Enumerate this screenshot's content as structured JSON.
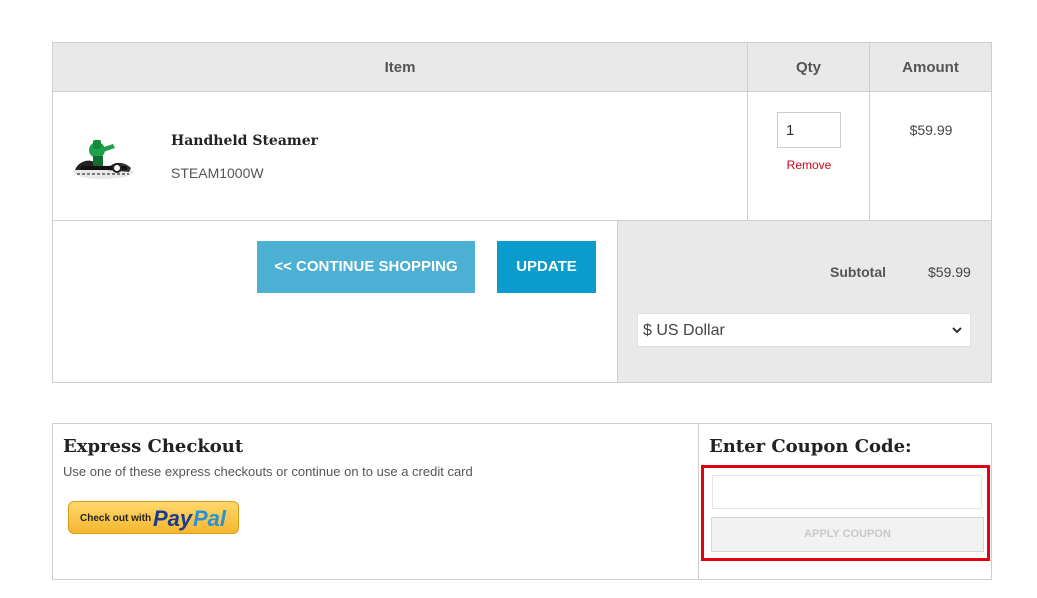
{
  "cart": {
    "headers": {
      "item": "Item",
      "qty": "Qty",
      "amount": "Amount"
    },
    "items": [
      {
        "name": "Handheld Steamer",
        "sku": "STEAM1000W",
        "qty": "1",
        "remove_label": "Remove",
        "amount": "$59.99",
        "image_icon": "steamer-product-image"
      }
    ],
    "continue_label": "<< CONTINUE SHOPPING",
    "update_label": "UPDATE",
    "subtotal_label": "Subtotal",
    "subtotal_value": "$59.99",
    "currency_selected": "$ US Dollar"
  },
  "checkout": {
    "express_title": "Express Checkout",
    "express_subtitle": "Use one of these express checkouts or continue on to use a credit card",
    "paypal": {
      "prefix": "Check out with",
      "pay": "Pay",
      "pal": "Pal"
    },
    "coupon_title": "Enter Coupon Code:",
    "coupon_value": "",
    "apply_label": "APPLY COUPON"
  },
  "colors": {
    "continue_button": "#4bb0d4",
    "update_button": "#0a9ccc",
    "remove_link": "#d0021b",
    "highlight_border": "#e3000f",
    "paypal_gold": "#f5b62f"
  }
}
